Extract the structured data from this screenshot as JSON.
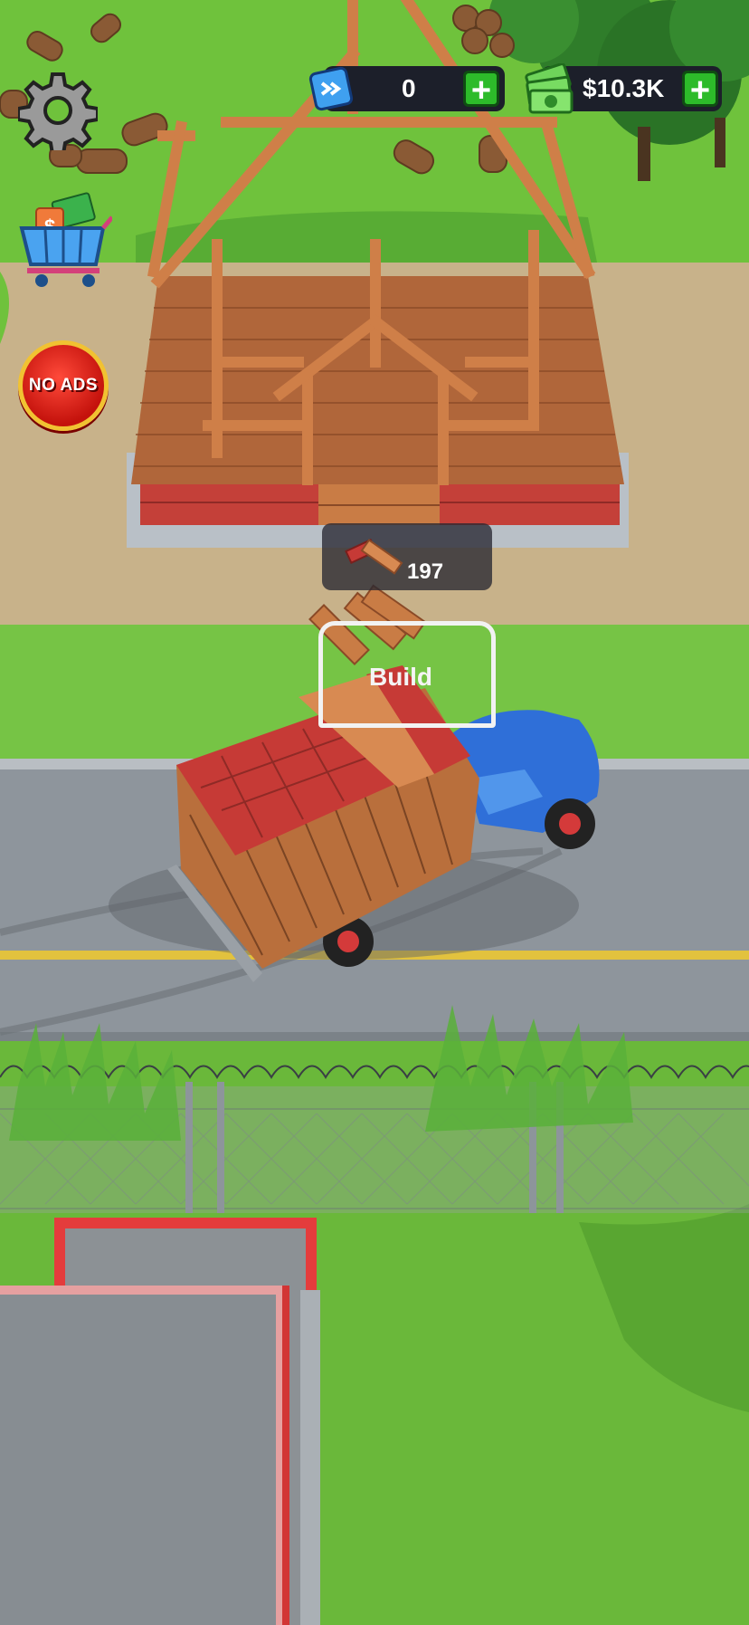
{
  "hud": {
    "gems_value": "0",
    "cash_value": "$10.3K",
    "plus_label": "+"
  },
  "buttons": {
    "no_ads_label": "NO ADS"
  },
  "build_site": {
    "material_count": "197",
    "zone_label": "Build"
  },
  "colors": {
    "grass": "#6fc23c",
    "road": "#8e959c",
    "dirt": "#c8b28a",
    "plus_button": "#2dbb2a",
    "truck_cab": "#2f6fd8",
    "bricks": "#c63a36",
    "planks": "#c97c45"
  },
  "icons": [
    "gear-icon",
    "shop-cart-icon",
    "gem-icon",
    "cash-icon",
    "plank-icon"
  ]
}
